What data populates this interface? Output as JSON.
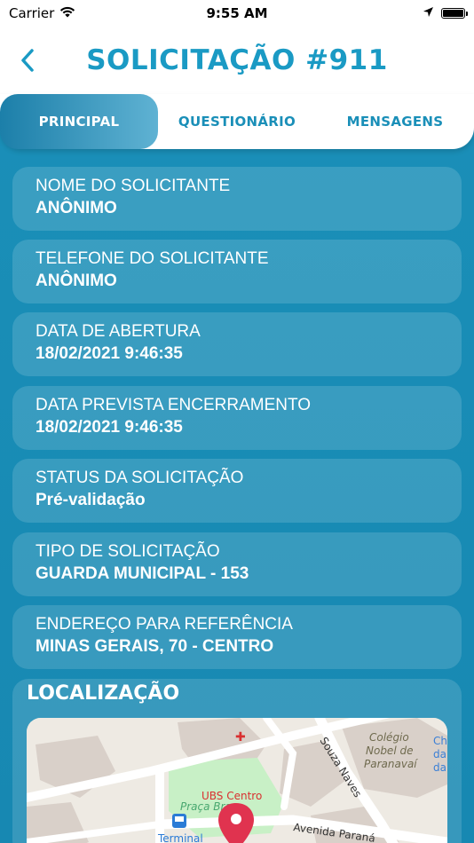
{
  "status_bar": {
    "carrier": "Carrier",
    "time": "9:55 AM"
  },
  "header": {
    "title": "SOLICITAÇÃO #911"
  },
  "tabs": [
    {
      "label": "PRINCIPAL",
      "active": true
    },
    {
      "label": "QUESTIONÁRIO",
      "active": false
    },
    {
      "label": "MENSAGENS",
      "active": false
    }
  ],
  "fields": [
    {
      "label": "NOME DO SOLICITANTE",
      "value": "ANÔNIMO"
    },
    {
      "label": "TELEFONE DO SOLICITANTE",
      "value": "ANÔNIMO"
    },
    {
      "label": "DATA DE ABERTURA",
      "value": "18/02/2021 9:46:35"
    },
    {
      "label": "DATA PREVISTA ENCERRAMENTO",
      "value": "18/02/2021 9:46:35"
    },
    {
      "label": "STATUS DA SOLICITAÇÃO",
      "value": "Pré-validação"
    },
    {
      "label": "TIPO DE SOLICITAÇÃO",
      "value": "GUARDA MUNICIPAL - 153"
    },
    {
      "label": "ENDEREÇO PARA REFERÊNCIA",
      "value": "MINAS GERAIS, 70 - CENTRO"
    }
  ],
  "location": {
    "title": "LOCALIZAÇÃO",
    "map_labels": {
      "ubs": "UBS Centro",
      "praca": "Praça Bra",
      "terminal": "Terminal",
      "avenida": "Avenida Paraná",
      "souza": "Souza Naves",
      "colegio_1": "Colégio",
      "colegio_2": "Nobel de",
      "colegio_3": "Paranavaí",
      "edge_1": "Ch",
      "edge_2": "da",
      "edge_3": "da"
    }
  },
  "colors": {
    "primary": "#1a8fb8",
    "title": "#1a9ac4",
    "map_pin": "#e0334f"
  }
}
